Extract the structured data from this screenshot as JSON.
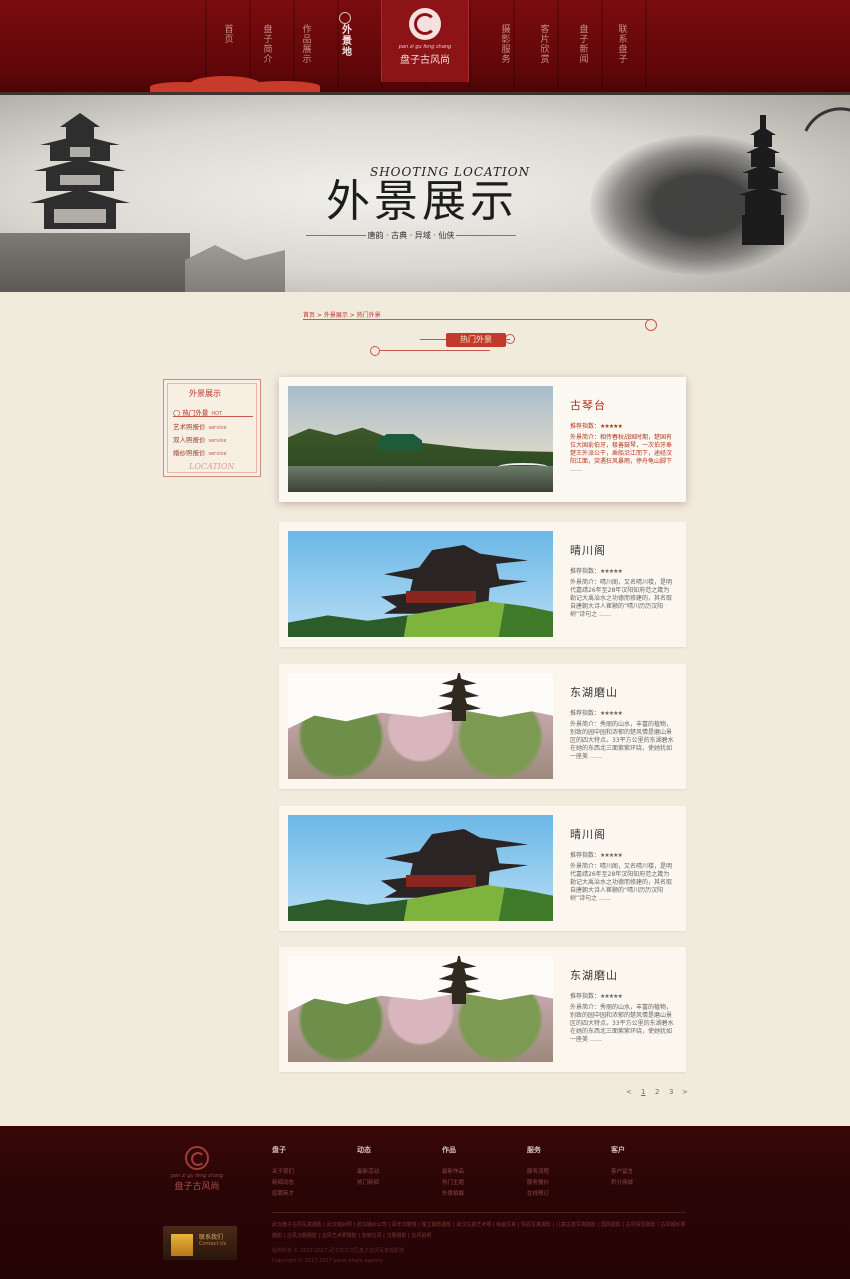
{
  "nav": {
    "items": [
      {
        "label": "首页"
      },
      {
        "label": "盘子简介"
      },
      {
        "label": "作品展示"
      },
      {
        "label": "外景地"
      },
      {
        "label": "摄影服务"
      },
      {
        "label": "客片欣赏"
      },
      {
        "label": "盘子新闻"
      },
      {
        "label": "联系盘子"
      }
    ],
    "logo_pinyin": "pan zi gu feng shang",
    "logo_cn": "盘子古风尚"
  },
  "banner": {
    "title": "外景展示",
    "title_en": "SHOOTING LOCATION",
    "subtitle": "唐韵 · 古典 · 异域 · 仙侠"
  },
  "breadcrumb": "首页 > 外景展示 > 热门外景",
  "section_tab": "热门外景",
  "sidebar": {
    "title": "外景展示",
    "items": [
      {
        "label": "热门外景",
        "en": "HOT",
        "active": true
      },
      {
        "label": "艺术照报价",
        "en": "service"
      },
      {
        "label": "双人照报价",
        "en": "service"
      },
      {
        "label": "婚纱照报价",
        "en": "service"
      }
    ],
    "footer_en": "LOCATION"
  },
  "cards": [
    {
      "title": "古琴台",
      "rating_label": "推荐指数：",
      "stars": "★★★★★",
      "photo": "lake-pavilion",
      "desc": "外景简介：相传春秋战国时期，楚国有位大国俞伯牙，极善鼓琴，一次伯牙奉楚王外派公干，乘船沿江而下，途经汉阳江面，突遇狂风暴雨，停舟龟山脚下 ……"
    },
    {
      "title": "晴川阁",
      "rating_label": "推荐指数：",
      "stars": "★★★★★",
      "photo": "tower",
      "desc": "外景简介：晴川阁，又名晴川楼，是明代嘉靖26年至28年汉阳知府范之箴为勒记大禹治水之功德而修建的，其名取自唐朝大诗人崔颢的“晴川历历汉阳树”诗句之 ……"
    },
    {
      "title": "东湖磨山",
      "rating_label": "推荐指数：",
      "stars": "★★★★★",
      "photo": "blossom-pagoda",
      "desc": "外景简介：秀丽的山水，丰富的植物，别致的园中园和浓郁的楚风情是磨山景区的四大特点。33平方公里的东湖碧水在她的东西北三面紫紫环绕，使她犹如一座美 ……"
    },
    {
      "title": "晴川阁",
      "rating_label": "推荐指数：",
      "stars": "★★★★★",
      "photo": "tower",
      "desc": "外景简介：晴川阁，又名晴川楼，是明代嘉靖26年至28年汉阳知府范之箴为勒记大禹治水之功德而修建的，其名取自唐朝大诗人崔颢的“晴川历历汉阳树”诗句之 ……"
    },
    {
      "title": "东湖磨山",
      "rating_label": "推荐指数：",
      "stars": "★★★★★",
      "photo": "blossom-pagoda",
      "desc": "外景简介：秀丽的山水，丰富的植物，别致的园中园和浓郁的楚风情是磨山景区的四大特点。33平方公里的东湖碧水在她的东西北三面紫紫环绕，使她犹如一座美 ……"
    }
  ],
  "pagination": {
    "prev": "<",
    "pages": [
      "1",
      "2",
      "3"
    ],
    "next": ">",
    "current": "1"
  },
  "footer": {
    "logo_pinyin": "pan zi gu feng shang",
    "logo_cn": "盘子古风尚",
    "columns": [
      {
        "heading": "盘子",
        "links": [
          "关于我们",
          "新闻动态",
          "招聘英才"
        ]
      },
      {
        "heading": "动态",
        "links": [
          "最新活动",
          "热门新闻"
        ]
      },
      {
        "heading": "作品",
        "links": [
          "最新作品",
          "热门主题",
          "外景拍摄"
        ]
      },
      {
        "heading": "服务",
        "links": [
          "服务流程",
          "服务报价",
          "在线预订"
        ]
      },
      {
        "heading": "客户",
        "links": [
          "客户留言",
          "积分商城"
        ]
      }
    ],
    "friend_links": "武汉盘子古风写真摄影 | 武汉婚纱照 | 武汉婚纱公司 | 百年汉服馆 | 独立摄影摄影 | 武汉古装艺术照 | 绘画写真 | 情侣写真摄影 | 儿童古装写真摄影 | 国风摄影 | 古风情侣摄影 | 古风婚纱照摄影 | 古风汉服摄影 | 古风艺术照摄影 | 定制古风 | 汉服摄影 | 古风拍照",
    "copyright_1": "版权所有 © 2017-2017 武汉市江汉区盘子古风写真摄影馆",
    "copyright_2": "Copyright © 2017-2017 panzi photo agency",
    "contact_cn": "联系我们",
    "contact_en": "Contact Us"
  }
}
